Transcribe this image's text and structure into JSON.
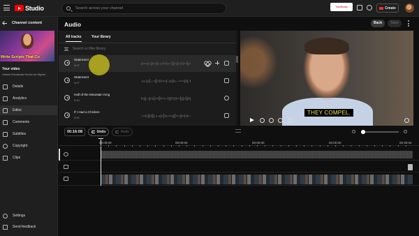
{
  "app": {
    "brand": "Studio",
    "accent": "#ff0000"
  },
  "search": {
    "placeholder": "Search across your channel"
  },
  "topbar": {
    "tab_badge": "TubeBuddy",
    "create_label": "Create"
  },
  "sidebar": {
    "back_label": "Channel content",
    "thumb_text": "Write Scripts That Co",
    "your_video_label": "Your video",
    "video_title": "Unlock Emotional Hooks for Higher ...",
    "items": [
      {
        "label": "Details",
        "icon": "pencil-icon"
      },
      {
        "label": "Analytics",
        "icon": "bar-chart-icon"
      },
      {
        "label": "Editor",
        "icon": "film-icon",
        "active": true
      },
      {
        "label": "Comments",
        "icon": "comment-icon"
      },
      {
        "label": "Subtitles",
        "icon": "subtitles-icon"
      },
      {
        "label": "Copyright",
        "icon": "copyright-icon"
      },
      {
        "label": "Clips",
        "icon": "scissors-icon"
      }
    ],
    "footer": [
      {
        "label": "Settings",
        "icon": "gear-icon"
      },
      {
        "label": "Send feedback",
        "icon": "feedback-icon"
      }
    ]
  },
  "editor": {
    "title": "Audio",
    "back_label": "Back",
    "save_label": "Save"
  },
  "audio": {
    "tabs": [
      "All tracks",
      "Your library"
    ],
    "filter_placeholder": "Search or filter library",
    "tracks": [
      {
        "name": "Statement",
        "duration": "3:07"
      },
      {
        "name": "Statement",
        "duration": "3:07"
      },
      {
        "name": "Hall of the Mountain King",
        "duration": "2:10"
      },
      {
        "name": "If I Had a Chicken",
        "duration": "2:31"
      }
    ]
  },
  "video": {
    "subtitle": "THEY COMPEL."
  },
  "timeline": {
    "current_time": "00:16:08",
    "undo_label": "Undo",
    "redo_label": "Redo",
    "ticks": [
      "00:00:00",
      "00:00:00",
      "00:00:00",
      "00:00:00",
      "00:30:04"
    ],
    "zoom_fraction": 0.05
  }
}
